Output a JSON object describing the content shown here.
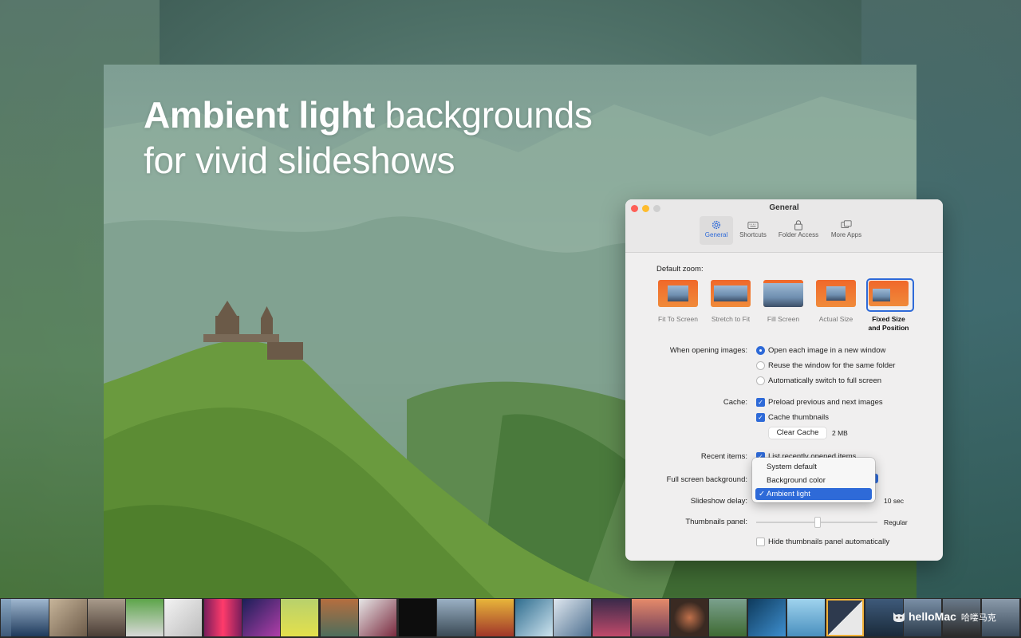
{
  "headline": {
    "bold": "Ambient light",
    "rest1": " backgrounds",
    "line2": "for vivid slideshows"
  },
  "window": {
    "title": "General",
    "toolbar": [
      {
        "label": "General",
        "icon": "gear-icon",
        "active": true
      },
      {
        "label": "Shortcuts",
        "icon": "keyboard-icon",
        "active": false
      },
      {
        "label": "Folder Access",
        "icon": "lock-icon",
        "active": false
      },
      {
        "label": "More Apps",
        "icon": "windows-icon",
        "active": false
      }
    ],
    "default_zoom_label": "Default zoom:",
    "zoom_options": [
      {
        "label": "Fit To Screen",
        "selected": false
      },
      {
        "label": "Stretch to Fit",
        "selected": false
      },
      {
        "label": "Fill Screen",
        "selected": false
      },
      {
        "label": "Actual Size",
        "selected": false
      },
      {
        "label": "Fixed Size\nand Position",
        "selected": true
      }
    ],
    "opening_label": "When opening images:",
    "opening_options": [
      {
        "label": "Open each image in a new window",
        "selected": true
      },
      {
        "label": "Reuse the window for the same folder",
        "selected": false
      },
      {
        "label": "Automatically switch to full screen",
        "selected": false
      }
    ],
    "cache_label": "Cache:",
    "cache_options": [
      {
        "label": "Preload previous and next images",
        "checked": true
      },
      {
        "label": "Cache thumbnails",
        "checked": true
      }
    ],
    "clear_cache_label": "Clear Cache",
    "cache_size": "2 MB",
    "recent_label": "Recent items:",
    "recent_option": {
      "label": "List recently opened items",
      "checked": true
    },
    "fullscreen_label": "Full screen background:",
    "fullscreen_menu": [
      {
        "label": "System default",
        "selected": false
      },
      {
        "label": "Background color",
        "selected": false
      },
      {
        "label": "Ambient light",
        "selected": true
      }
    ],
    "slideshow_label": "Slideshow delay:",
    "slideshow_value": "10 sec",
    "thumbnails_label": "Thumbnails panel:",
    "thumbnails_value": "Regular",
    "hide_thumbs": {
      "label": "Hide thumbnails panel automatically",
      "checked": false
    }
  },
  "watermark": {
    "brand": "helloMac",
    "cn": "哈喽马克"
  },
  "colors": {
    "accent": "#2e6ad8",
    "filmstrip_selected": "#f3b33a"
  }
}
